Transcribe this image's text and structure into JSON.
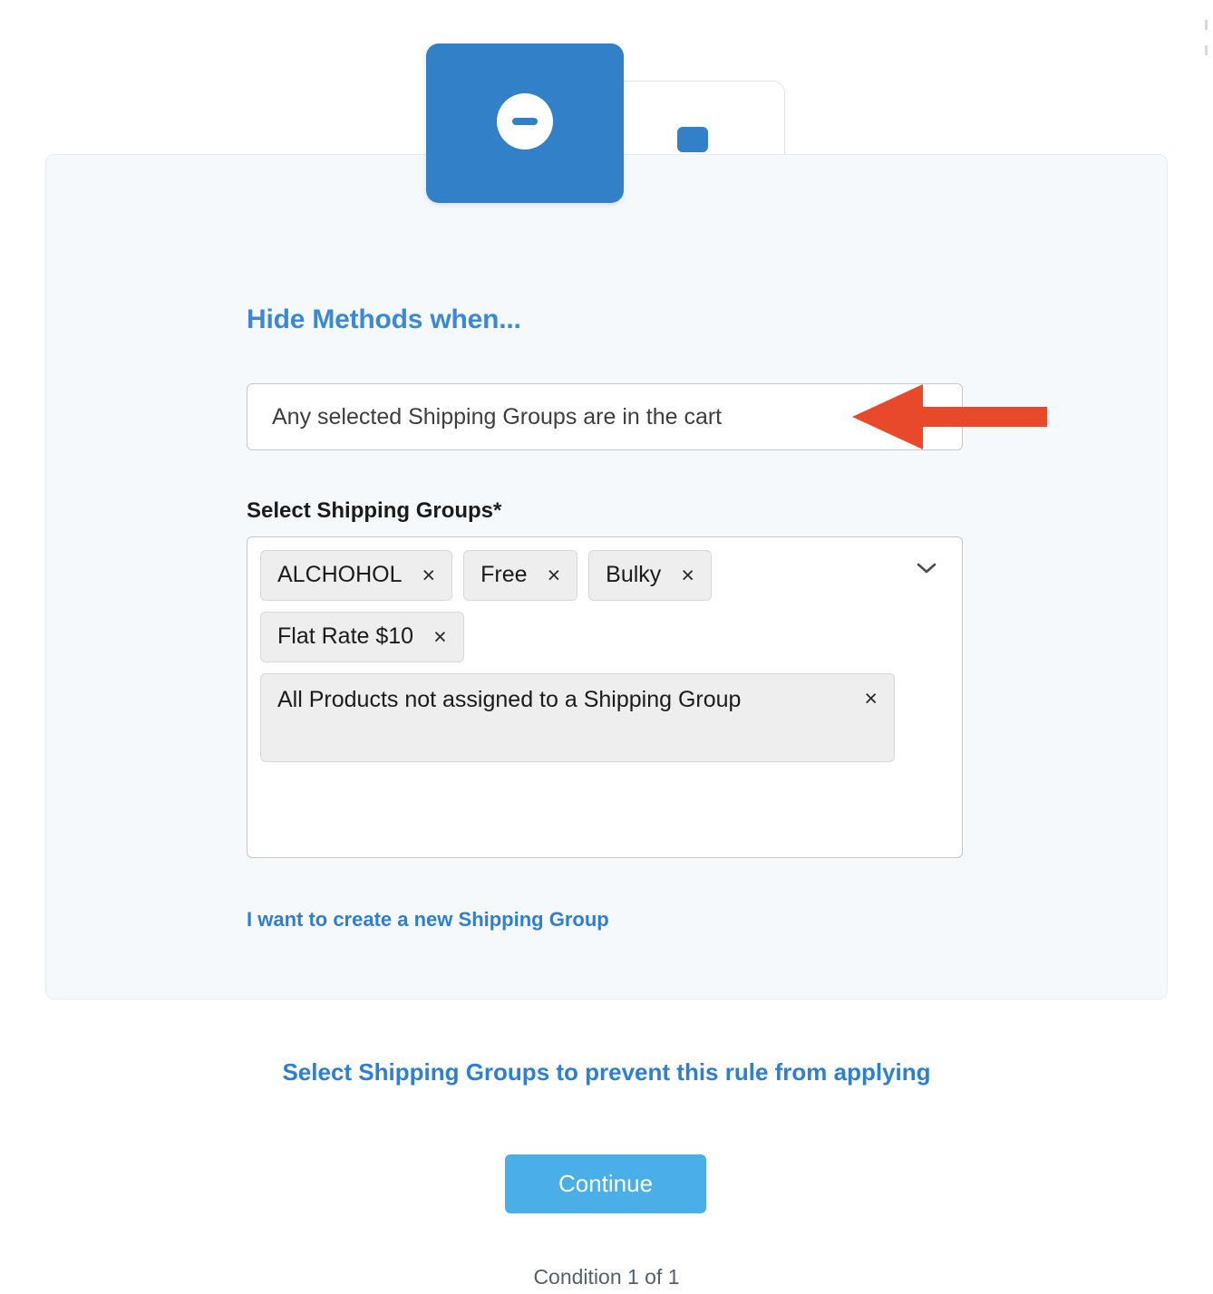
{
  "icons": {
    "hide_card": "minus-circle-icon",
    "group_card": "shipping-boxes-icon"
  },
  "colors": {
    "brand_blue": "#3180c8",
    "link_blue": "#2e7fd1",
    "heading_blue": "#3b88d4",
    "button_blue": "#4aaee8",
    "panel_bg": "#f6f9fc",
    "tag_bg": "#eeeeee",
    "arrow_red": "#e8492a"
  },
  "heading": "Hide Methods when...",
  "condition": {
    "selected": "Any selected Shipping Groups are in the cart"
  },
  "shipping_groups_field": {
    "label": "Select Shipping Groups",
    "required_marker": "*",
    "tags": [
      {
        "label": "ALCHOHOL",
        "remove": "×"
      },
      {
        "label": "Free",
        "remove": "×"
      },
      {
        "label": "Bulky",
        "remove": "×"
      },
      {
        "label": "Flat Rate $10",
        "remove": "×"
      },
      {
        "label": "All Products not assigned to a Shipping Group",
        "remove": "×"
      }
    ],
    "dropdown_icon": "chevron-down-icon"
  },
  "links": {
    "create_group": "I want to create a new Shipping Group",
    "prevent_rule": "Select Shipping Groups to prevent this rule from applying"
  },
  "actions": {
    "continue": "Continue"
  },
  "footer": {
    "condition_counter": "Condition 1 of 1"
  }
}
